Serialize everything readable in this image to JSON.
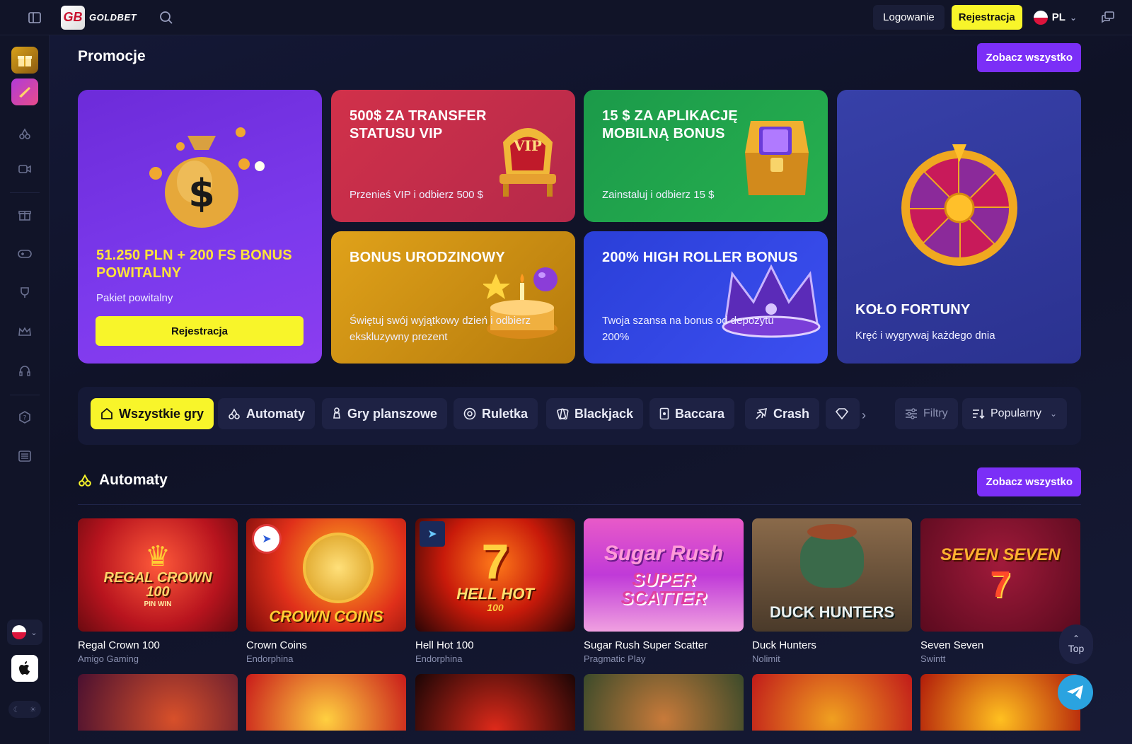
{
  "topbar": {
    "brand": "GOLDBET",
    "logo_mark": "GB",
    "login_label": "Logowanie",
    "register_label": "Rejestracja",
    "lang": "PL"
  },
  "promotions": {
    "title": "Promocje",
    "see_all": "Zobacz wszystko",
    "cards": {
      "welcome": {
        "title": "51.250 PLN + 200 FS BONUS POWITALNY",
        "subtitle": "Pakiet powitalny",
        "cta": "Rejestracja"
      },
      "vip": {
        "title": "500$ ZA TRANSFER STATUSU VIP",
        "subtitle": "Przenieś VIP i odbierz 500 $",
        "badge": "VIP"
      },
      "app": {
        "title": "15 $ ZA APLIKACJĘ MOBILNĄ BONUS",
        "subtitle": "Zainstaluj i odbierz 15 $"
      },
      "birthday": {
        "title": "BONUS URODZINOWY",
        "subtitle": "Świętuj swój wyjątkowy dzień i odbierz ekskluzywny prezent"
      },
      "roller": {
        "title": "200% HIGH ROLLER BONUS",
        "subtitle": "Twoja szansa na bonus od depozytu 200%"
      },
      "wheel": {
        "title": "KOŁO FORTUNY",
        "subtitle": "Kręć i wygrywaj każdego dnia"
      }
    }
  },
  "filters": {
    "tabs": [
      {
        "label": "Wszystkie gry",
        "icon": "home-icon"
      },
      {
        "label": "Automaty",
        "icon": "cherry-icon"
      },
      {
        "label": "Gry planszowe",
        "icon": "pawn-icon"
      },
      {
        "label": "Ruletka",
        "icon": "roulette-icon"
      },
      {
        "label": "Blackjack",
        "icon": "cards-icon"
      },
      {
        "label": "Baccara",
        "icon": "card-icon"
      },
      {
        "label": "Crash",
        "icon": "plane-icon"
      }
    ],
    "filter_label": "Filtry",
    "sort_label": "Popularny"
  },
  "slots": {
    "title": "Automaty",
    "see_all": "Zobacz wszystko",
    "games": [
      {
        "name": "Regal Crown 100",
        "provider": "Amigo Gaming",
        "art": "REGAL CROWN 100",
        "art_sub": "PIN WIN"
      },
      {
        "name": "Crown Coins",
        "provider": "Endorphina",
        "art": "CROWN COINS"
      },
      {
        "name": "Hell Hot 100",
        "provider": "Endorphina",
        "art": "HELL HOT",
        "art_sub": "100"
      },
      {
        "name": "Sugar Rush Super Scatter",
        "provider": "Pragmatic Play",
        "art": "Sugar Rush",
        "art_sub": "SUPER SCATTER"
      },
      {
        "name": "Duck Hunters",
        "provider": "Nolimit",
        "art": "DUCK HUNTERS"
      },
      {
        "name": "Seven Seven",
        "provider": "Swintt",
        "art": "SEVEN SEVEN"
      }
    ]
  },
  "floating": {
    "top_label": "Top"
  },
  "colors": {
    "accent_yellow": "#f8f52a",
    "accent_purple": "#7b2ff7",
    "bg": "#0f1226"
  }
}
